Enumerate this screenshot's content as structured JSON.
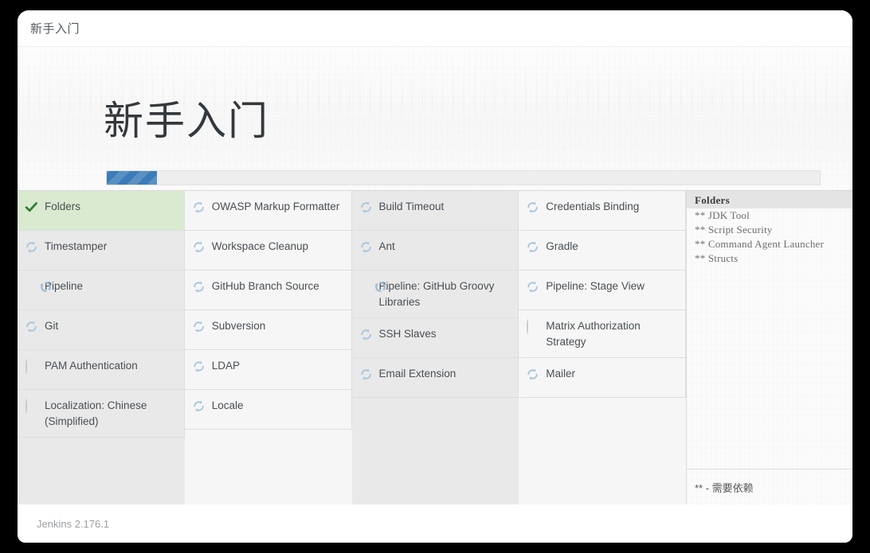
{
  "window": {
    "titlebar_text": "新手入门"
  },
  "header": {
    "heading": "新手入门",
    "progress": {
      "percent": 7,
      "fill_color": "#3a7cb8",
      "track_color": "#eeeeee"
    }
  },
  "colors": {
    "installed_row_bg": "#d9ead1",
    "check_green": "#2f7d32",
    "spinner_blue": "#a9c4dc",
    "spinner_blue_active": "#9fbbd4",
    "queued_grey": "#c6cacd"
  },
  "plugin_grid": {
    "columns": [
      {
        "shade": "a",
        "cells": [
          {
            "label": "Folders",
            "status": "installed",
            "icon": "check-icon"
          },
          {
            "label": "Timestamper",
            "status": "pending",
            "icon": "spinner-icon"
          },
          {
            "label": "Pipeline",
            "status": "installing",
            "icon": "spinner-icon"
          },
          {
            "label": "Git",
            "status": "pending",
            "icon": "spinner-icon"
          },
          {
            "label": "PAM Authentication",
            "status": "queued",
            "icon": "circle-icon"
          },
          {
            "label": "Localization: Chinese (Simplified)",
            "status": "queued",
            "icon": "circle-icon"
          }
        ]
      },
      {
        "shade": "b",
        "cells": [
          {
            "label": "OWASP Markup Formatter",
            "status": "pending",
            "icon": "spinner-icon"
          },
          {
            "label": "Workspace Cleanup",
            "status": "pending",
            "icon": "spinner-icon"
          },
          {
            "label": "GitHub Branch Source",
            "status": "pending",
            "icon": "spinner-icon"
          },
          {
            "label": "Subversion",
            "status": "pending",
            "icon": "spinner-icon"
          },
          {
            "label": "LDAP",
            "status": "pending",
            "icon": "spinner-icon"
          },
          {
            "label": "Locale",
            "status": "pending",
            "icon": "spinner-icon"
          }
        ]
      },
      {
        "shade": "a",
        "cells": [
          {
            "label": "Build Timeout",
            "status": "pending",
            "icon": "spinner-icon"
          },
          {
            "label": "Ant",
            "status": "pending",
            "icon": "spinner-icon"
          },
          {
            "label": "Pipeline: GitHub Groovy Libraries",
            "status": "installing",
            "icon": "spinner-icon"
          },
          {
            "label": "SSH Slaves",
            "status": "pending",
            "icon": "spinner-icon"
          },
          {
            "label": "Email Extension",
            "status": "pending",
            "icon": "spinner-icon"
          },
          {
            "label": "",
            "status": "empty",
            "icon": ""
          }
        ]
      },
      {
        "shade": "b",
        "cells": [
          {
            "label": "Credentials Binding",
            "status": "pending",
            "icon": "spinner-icon"
          },
          {
            "label": "Gradle",
            "status": "pending",
            "icon": "spinner-icon"
          },
          {
            "label": "Pipeline: Stage View",
            "status": "pending",
            "icon": "spinner-icon"
          },
          {
            "label": "Matrix Authorization Strategy",
            "status": "queued",
            "icon": "circle-icon"
          },
          {
            "label": "Mailer",
            "status": "pending",
            "icon": "spinner-icon"
          },
          {
            "label": "",
            "status": "empty",
            "icon": ""
          }
        ]
      }
    ]
  },
  "log_panel": {
    "current_plugin": "Folders",
    "dependencies": [
      "** JDK Tool",
      "** Script Security",
      "** Command Agent Launcher",
      "** Structs"
    ],
    "legend": "** - 需要依赖"
  },
  "footer": {
    "version": "Jenkins 2.176.1"
  }
}
